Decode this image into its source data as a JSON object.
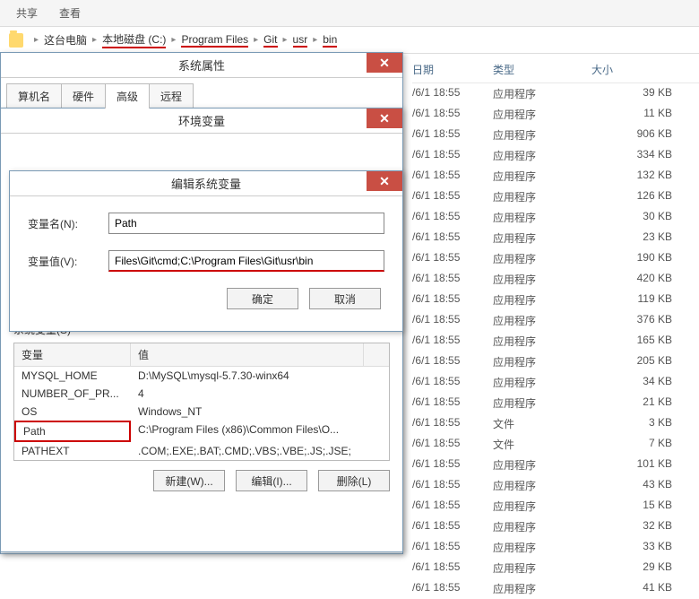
{
  "toolbar": {
    "share": "共享",
    "view": "查看"
  },
  "breadcrumb": {
    "items": [
      "这台电脑",
      "本地磁盘 (C:)",
      "Program Files",
      "Git",
      "usr",
      "bin"
    ]
  },
  "fileList": {
    "headers": {
      "date": "日期",
      "type": "类型",
      "size": "大小"
    },
    "rows": [
      {
        "date": "/6/1 18:55",
        "type": "应用程序",
        "size": "39 KB"
      },
      {
        "date": "/6/1 18:55",
        "type": "应用程序",
        "size": "11 KB"
      },
      {
        "date": "/6/1 18:55",
        "type": "应用程序",
        "size": "906 KB"
      },
      {
        "date": "/6/1 18:55",
        "type": "应用程序",
        "size": "334 KB"
      },
      {
        "date": "/6/1 18:55",
        "type": "应用程序",
        "size": "132 KB"
      },
      {
        "date": "/6/1 18:55",
        "type": "应用程序",
        "size": "126 KB"
      },
      {
        "date": "/6/1 18:55",
        "type": "应用程序",
        "size": "30 KB"
      },
      {
        "date": "/6/1 18:55",
        "type": "应用程序",
        "size": "23 KB"
      },
      {
        "date": "/6/1 18:55",
        "type": "应用程序",
        "size": "190 KB"
      },
      {
        "date": "/6/1 18:55",
        "type": "应用程序",
        "size": "420 KB"
      },
      {
        "date": "/6/1 18:55",
        "type": "应用程序",
        "size": "119 KB"
      },
      {
        "date": "/6/1 18:55",
        "type": "应用程序",
        "size": "376 KB"
      },
      {
        "date": "/6/1 18:55",
        "type": "应用程序",
        "size": "165 KB"
      },
      {
        "date": "/6/1 18:55",
        "type": "应用程序",
        "size": "205 KB"
      },
      {
        "date": "/6/1 18:55",
        "type": "应用程序",
        "size": "34 KB"
      },
      {
        "date": "/6/1 18:55",
        "type": "应用程序",
        "size": "21 KB"
      },
      {
        "date": "/6/1 18:55",
        "type": "文件",
        "size": "3 KB"
      },
      {
        "date": "/6/1 18:55",
        "type": "文件",
        "size": "7 KB"
      },
      {
        "date": "/6/1 18:55",
        "type": "应用程序",
        "size": "101 KB"
      },
      {
        "date": "/6/1 18:55",
        "type": "应用程序",
        "size": "43 KB"
      },
      {
        "date": "/6/1 18:55",
        "type": "应用程序",
        "size": "15 KB"
      },
      {
        "date": "/6/1 18:55",
        "type": "应用程序",
        "size": "32 KB"
      },
      {
        "date": "/6/1 18:55",
        "type": "应用程序",
        "size": "33 KB"
      },
      {
        "date": "/6/1 18:55",
        "type": "应用程序",
        "size": "29 KB"
      },
      {
        "date": "/6/1 18:55",
        "type": "应用程序",
        "size": "41 KB"
      }
    ]
  },
  "sysProps": {
    "title": "系统属性",
    "tabs": [
      "算机名",
      "硬件",
      "高级",
      "远程"
    ],
    "activeTab": 2
  },
  "envVars": {
    "title": "环境变量",
    "groupLabel": "系统变量(S)",
    "cols": {
      "name": "变量",
      "value": "值"
    },
    "rows": [
      {
        "name": "MYSQL_HOME",
        "value": "D:\\MySQL\\mysql-5.7.30-winx64"
      },
      {
        "name": "NUMBER_OF_PR...",
        "value": "4"
      },
      {
        "name": "OS",
        "value": "Windows_NT"
      },
      {
        "name": "Path",
        "value": "C:\\Program Files (x86)\\Common Files\\O..."
      },
      {
        "name": "PATHEXT",
        "value": ".COM;.EXE;.BAT;.CMD;.VBS;.VBE;.JS;.JSE;"
      }
    ],
    "selectedRow": 3,
    "buttons": {
      "new": "新建(W)...",
      "edit": "编辑(I)...",
      "delete": "删除(L)"
    }
  },
  "editVar": {
    "title": "编辑系统变量",
    "nameLabel": "变量名(N):",
    "valueLabel": "变量值(V):",
    "nameValue": "Path",
    "valueValue": "Files\\Git\\cmd;C:\\Program Files\\Git\\usr\\bin",
    "ok": "确定",
    "cancel": "取消"
  }
}
